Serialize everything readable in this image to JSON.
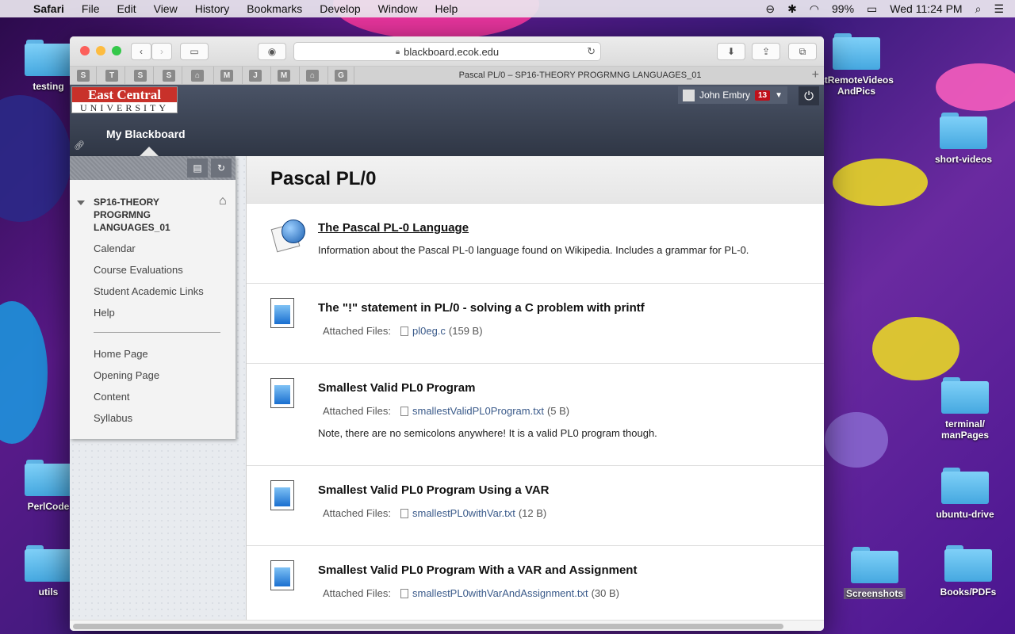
{
  "menubar": {
    "apple": "",
    "app": "Safari",
    "items": [
      "File",
      "Edit",
      "View",
      "History",
      "Bookmarks",
      "Develop",
      "Window",
      "Help"
    ],
    "battery": "99%",
    "clock": "Wed 11:24 PM"
  },
  "desktop": {
    "icons": [
      "testing",
      "PerlCode",
      "utils",
      "stRemoteVideos AndPics",
      "short-videos",
      "terminal/ manPages",
      "ubuntu-drive",
      "Screenshots",
      "Books/PDFs"
    ]
  },
  "browser": {
    "url": "blackboard.ecok.edu",
    "favicons": [
      "S",
      "T",
      "S",
      "S",
      "⌂",
      "M",
      "J",
      "M",
      "⌂",
      "G"
    ],
    "tab_title": "Pascal PL/0 – SP16-THEORY PROGRMNG LANGUAGES_01",
    "new_tab": "+"
  },
  "header": {
    "logo_line1": "East Central",
    "logo_line2": "UNIVERSITY",
    "user_name": "John Embry",
    "notification_count": "13",
    "nav_tab": "My Blackboard"
  },
  "sidebar": {
    "course_title": "SP16-THEORY PROGRMNG LANGUAGES_01",
    "links_top": [
      "Calendar",
      "Course Evaluations",
      "Student Academic Links",
      "Help"
    ],
    "links_bottom": [
      "Home Page",
      "Opening Page",
      "Content",
      "Syllabus"
    ]
  },
  "main": {
    "page_title": "Pascal PL/0",
    "attached_label": "Attached Files:",
    "items": [
      {
        "title": "The Pascal PL-0 Language",
        "description": "Information about the Pascal PL-0 language found on Wikipedia. Includes a grammar for PL-0."
      },
      {
        "title": "The \"!\" statement in PL/0 - solving a C problem with printf",
        "file": "pl0eg.c",
        "size": "(159 B)"
      },
      {
        "title": "Smallest Valid PL0 Program",
        "file": "smallestValidPL0Program.txt",
        "size": "(5 B)",
        "note": "Note, there are no semicolons anywhere! It is a valid PL0 program though."
      },
      {
        "title": "Smallest Valid PL0 Program Using a VAR",
        "file": "smallestPL0withVar.txt",
        "size": "(12 B)"
      },
      {
        "title": "Smallest Valid PL0 Program With a VAR and Assignment",
        "file": "smallestPL0withVarAndAssignment.txt",
        "size": "(30 B)"
      }
    ]
  }
}
